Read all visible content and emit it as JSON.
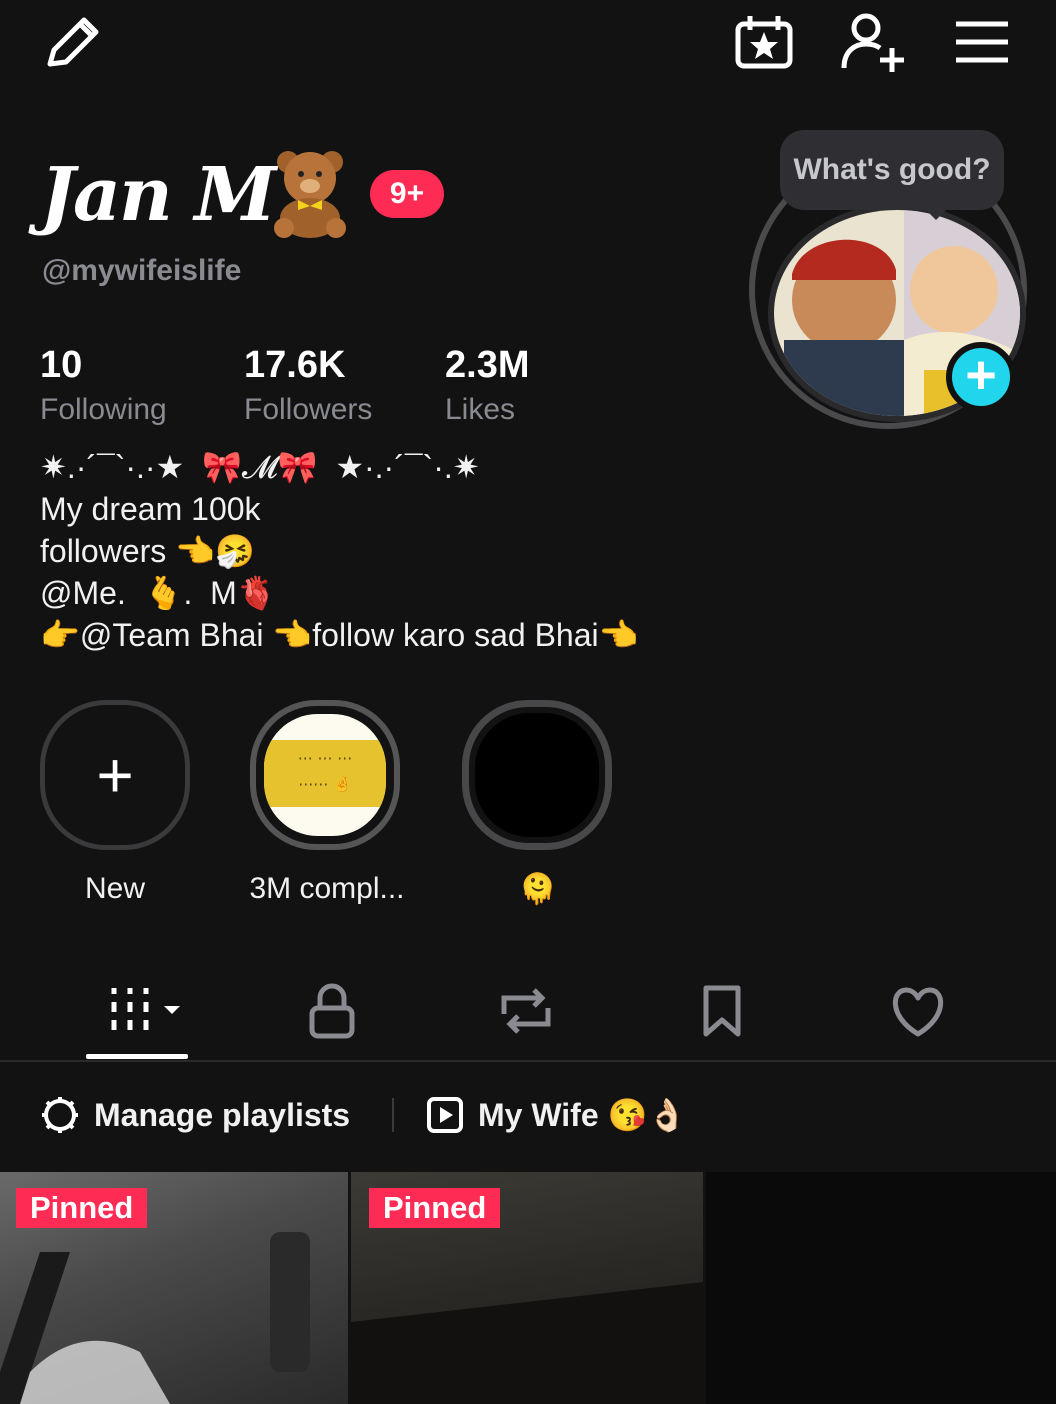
{
  "topbar": {
    "edit_icon": "pencil-icon",
    "calendar_icon": "calendar-star-icon",
    "add_friend_icon": "add-user-icon",
    "menu_icon": "hamburger-menu-icon"
  },
  "profile": {
    "display_name": "Jan M",
    "name_emoji": "teddy-bear",
    "notification_badge": "9+",
    "username": "@mywifeislife",
    "status_bubble": "What's good?"
  },
  "stats": [
    {
      "value": "10",
      "label": "Following"
    },
    {
      "value": "17.6K",
      "label": "Followers"
    },
    {
      "value": "2.3M",
      "label": "Likes"
    }
  ],
  "bio": {
    "line1": "✷.·´¯`·.·★  🎀𝓜🎀  ★·.·´¯`·.✷",
    "line2": "My dream 100k",
    "line3": "followers 👈🤧",
    "line4": "@Me.  🫰.  M🫀",
    "line5": "👉@Team Bhai 👈follow karo sad Bhai👈"
  },
  "highlights": [
    {
      "label": "New",
      "icon": "plus-icon"
    },
    {
      "label": "3M compl..."
    },
    {
      "label": "🫠"
    }
  ],
  "tabs": [
    {
      "name": "videos",
      "icon": "grid-icon",
      "active": true
    },
    {
      "name": "private",
      "icon": "lock-icon"
    },
    {
      "name": "reposts",
      "icon": "repost-icon"
    },
    {
      "name": "saved",
      "icon": "bookmark-icon"
    },
    {
      "name": "liked",
      "icon": "heart-icon"
    }
  ],
  "playlists": {
    "manage_label": "Manage playlists",
    "playlist_label": "My Wife 😘👌🏻"
  },
  "videos": [
    {
      "badge": "Pinned"
    },
    {
      "badge": "Pinned"
    },
    {
      "badge": ""
    }
  ],
  "colors": {
    "background": "#121212",
    "accent_red": "#fe2c55",
    "accent_cyan": "#20d5ec",
    "muted_text": "#8a8b91"
  }
}
